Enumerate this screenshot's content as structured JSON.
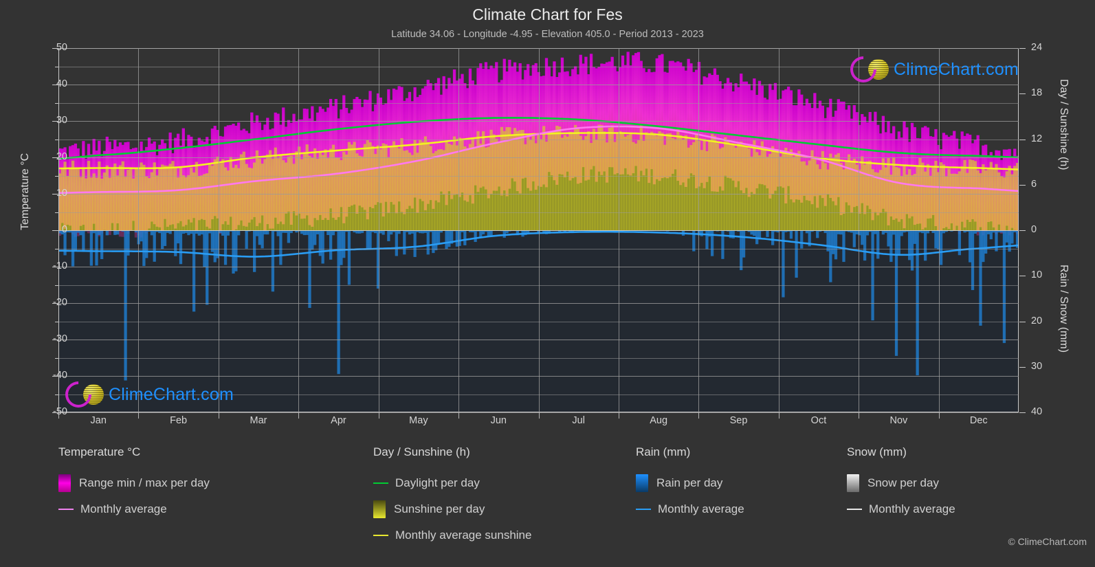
{
  "header": {
    "title": "Climate Chart for Fes",
    "subtitle": "Latitude 34.06 - Longitude -4.95 - Elevation 405.0 - Period 2013 - 2023"
  },
  "branding": {
    "name": "ClimeChart.com",
    "copyright": "© ClimeChart.com",
    "colors": {
      "ring": "#cc22cc",
      "ball": "#d9c92c",
      "text": "#1e90ff"
    }
  },
  "axes": {
    "left": {
      "label": "Temperature °C",
      "ticks": [
        "50",
        "40",
        "30",
        "20",
        "10",
        "0",
        "-10",
        "-20",
        "-30",
        "-40",
        "-50"
      ],
      "min": -50,
      "max": 50
    },
    "right_top": {
      "label": "Day / Sunshine (h)",
      "ticks": [
        "24",
        "18",
        "12",
        "6",
        "0"
      ],
      "min": 0,
      "max": 24
    },
    "right_bottom": {
      "label": "Rain / Snow (mm)",
      "ticks": [
        "0",
        "10",
        "20",
        "30",
        "40"
      ],
      "min": 0,
      "max": 40
    },
    "x": {
      "ticks": [
        "Jan",
        "Feb",
        "Mar",
        "Apr",
        "May",
        "Jun",
        "Jul",
        "Aug",
        "Sep",
        "Oct",
        "Nov",
        "Dec"
      ]
    }
  },
  "legend": {
    "groups": [
      {
        "title": "Temperature °C",
        "items": [
          {
            "label": "Range min / max per day",
            "swatch": "gradient",
            "color": "#ff00e6",
            "name": "temp-range-swatch"
          },
          {
            "label": "Monthly average",
            "swatch": "line",
            "color": "#ee82ee",
            "name": "temp-avg-line-swatch"
          }
        ]
      },
      {
        "title": "Day / Sunshine (h)",
        "items": [
          {
            "label": "Daylight per day",
            "swatch": "line",
            "color": "#00cc33",
            "name": "daylight-line-swatch"
          },
          {
            "label": "Sunshine per day",
            "swatch": "gradient",
            "color": "#e8e830",
            "name": "sunshine-area-swatch"
          },
          {
            "label": "Monthly average sunshine",
            "swatch": "line",
            "color": "#e8e830",
            "name": "sunshine-avg-line-swatch"
          }
        ]
      },
      {
        "title": "Rain (mm)",
        "items": [
          {
            "label": "Rain per day",
            "swatch": "gradient",
            "color": "#1e90ff",
            "name": "rain-bar-swatch"
          },
          {
            "label": "Monthly average",
            "swatch": "line",
            "color": "#2a9df4",
            "name": "rain-avg-line-swatch"
          }
        ]
      },
      {
        "title": "Snow (mm)",
        "items": [
          {
            "label": "Snow per day",
            "swatch": "gradient",
            "color": "#e8e8e8",
            "name": "snow-bar-swatch"
          },
          {
            "label": "Monthly average",
            "swatch": "line",
            "color": "#e8e8e8",
            "name": "snow-avg-line-swatch"
          }
        ]
      }
    ]
  },
  "chart_data": {
    "type": "line",
    "title": "Climate Chart for Fes",
    "subtitle": "Latitude 34.06 - Longitude -4.95 - Elevation 405.0 - Period 2013 - 2023",
    "xlabel": "",
    "ylabel": "Temperature °C",
    "ylim": [
      -50,
      50
    ],
    "grid": true,
    "legend_position": "below",
    "categories": [
      "Jan",
      "Feb",
      "Mar",
      "Apr",
      "May",
      "Jun",
      "Jul",
      "Aug",
      "Sep",
      "Oct",
      "Nov",
      "Dec"
    ],
    "series": [
      {
        "name": "Monthly average temperature (°C)",
        "axis": "left",
        "color": "#ee82ee",
        "values": [
          10.5,
          11.0,
          13.5,
          15.5,
          19.0,
          24.0,
          28.0,
          28.0,
          24.0,
          19.5,
          13.0,
          11.5
        ]
      },
      {
        "name": "Daily max temperature (°C)",
        "axis": "left",
        "color": "#ff00e6",
        "values": [
          22,
          24,
          29,
          33,
          38,
          43,
          45,
          45,
          40,
          34,
          27,
          23
        ]
      },
      {
        "name": "Daily min temperature (°C)",
        "axis": "left",
        "color": "#ff00e6",
        "values": [
          0,
          1,
          2,
          4,
          7,
          11,
          15,
          15,
          12,
          8,
          3,
          1
        ]
      },
      {
        "name": "Daylight per day (h)",
        "axis": "right_top",
        "color": "#00cc33",
        "values": [
          9.9,
          10.8,
          12.0,
          13.3,
          14.3,
          14.8,
          14.6,
          13.7,
          12.5,
          11.3,
          10.2,
          9.8
        ]
      },
      {
        "name": "Monthly average sunshine (h)",
        "axis": "right_top",
        "color": "#e8e830",
        "values": [
          8.2,
          8.3,
          9.6,
          10.5,
          11.3,
          12.4,
          12.8,
          12.6,
          11.2,
          9.5,
          8.6,
          8.2
        ]
      },
      {
        "name": "Monthly average rain (mm)",
        "axis": "right_bottom",
        "color": "#2a9df4",
        "values": [
          4.6,
          4.8,
          5.8,
          4.4,
          3.6,
          1.2,
          0.4,
          0.5,
          1.4,
          3.2,
          5.4,
          4.0
        ]
      },
      {
        "name": "Monthly average snow (mm)",
        "axis": "right_bottom",
        "color": "#e8e8e8",
        "values": [
          0,
          0,
          0,
          0,
          0,
          0,
          0,
          0,
          0,
          0,
          0,
          0
        ]
      }
    ]
  }
}
